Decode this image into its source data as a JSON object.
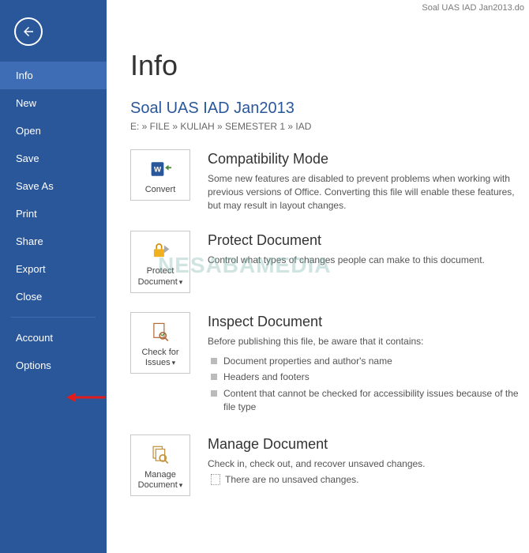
{
  "titleBar": "Soal UAS IAD Jan2013.do",
  "sidebar": {
    "items": [
      {
        "label": "Info",
        "active": true
      },
      {
        "label": "New"
      },
      {
        "label": "Open"
      },
      {
        "label": "Save"
      },
      {
        "label": "Save As"
      },
      {
        "label": "Print"
      },
      {
        "label": "Share"
      },
      {
        "label": "Export"
      },
      {
        "label": "Close"
      }
    ],
    "bottom": [
      {
        "label": "Account"
      },
      {
        "label": "Options"
      }
    ]
  },
  "heading": "Info",
  "docTitle": "Soal UAS IAD Jan2013",
  "breadcrumb": "E: » FILE » KULIAH » SEMESTER 1 » IAD",
  "sections": {
    "compat": {
      "tile": "Convert",
      "title": "Compatibility Mode",
      "desc": "Some new features are disabled to prevent problems when working with previous versions of Office. Converting this file will enable these features, but may result in layout changes."
    },
    "protect": {
      "tile": "Protect Document",
      "title": "Protect Document",
      "desc": "Control what types of changes people can make to this document."
    },
    "inspect": {
      "tile": "Check for Issues",
      "title": "Inspect Document",
      "desc": "Before publishing this file, be aware that it contains:",
      "bullets": [
        "Document properties and author's name",
        "Headers and footers",
        "Content that cannot be checked for accessibility issues because of the file type"
      ]
    },
    "manage": {
      "tile": "Manage Document",
      "title": "Manage Document",
      "desc": "Check in, check out, and recover unsaved changes.",
      "unsaved": "There are no unsaved changes."
    }
  },
  "watermark": "NESABAMEDIA",
  "colors": {
    "brand": "#2a579a"
  }
}
